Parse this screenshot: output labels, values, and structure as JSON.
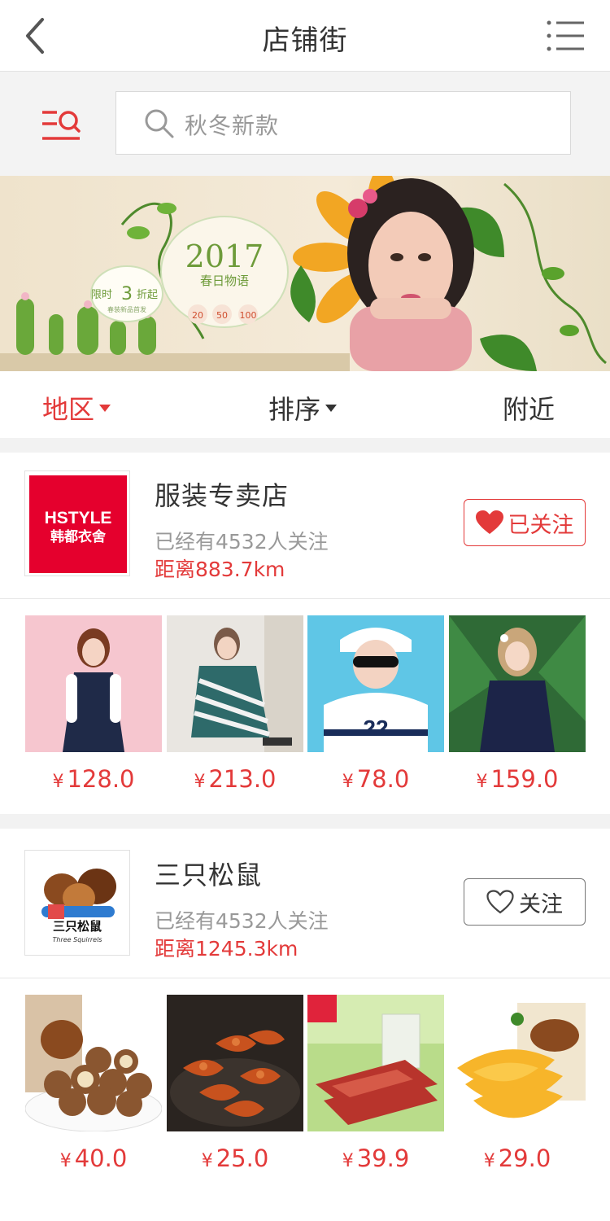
{
  "header": {
    "title": "店铺街"
  },
  "search": {
    "placeholder": "秋冬新款"
  },
  "banner": {
    "promo_prefix": "限时",
    "promo_number": "3",
    "promo_suffix": "折起",
    "promo_sub": "春装新品首发",
    "year": "2017",
    "tagline": "春日物语",
    "coupons": [
      "20",
      "50",
      "100"
    ]
  },
  "tabs": {
    "region": "地区",
    "sort": "排序",
    "nearby": "附近"
  },
  "stores": [
    {
      "name": "服装专卖店",
      "logo_text_1": "HSTYLE",
      "logo_text_2": "韩都衣舍",
      "followers": "已经有4532人关注",
      "distance": "距离883.7km",
      "follow_label": "已关注",
      "products": [
        {
          "currency": "¥",
          "price": "128.0"
        },
        {
          "currency": "¥",
          "price": "213.0"
        },
        {
          "currency": "¥",
          "price": "78.0"
        },
        {
          "currency": "¥",
          "price": "159.0"
        }
      ]
    },
    {
      "name": "三只松鼠",
      "logo_text_1": "三只松鼠",
      "logo_text_2": "Three Squirrels",
      "followers": "已经有4532人关注",
      "distance": "距离1245.3km",
      "follow_label": "关注",
      "products": [
        {
          "currency": "¥",
          "price": "40.0"
        },
        {
          "currency": "¥",
          "price": "25.0"
        },
        {
          "currency": "¥",
          "price": "39.9"
        },
        {
          "currency": "¥",
          "price": "29.0"
        }
      ]
    }
  ],
  "colors": {
    "accent": "#e33a3a",
    "logo_red": "#e5002d",
    "band": "#f2f2f2"
  },
  "icons": [
    "back-arrow-icon",
    "list-menu-icon",
    "filter-search-icon",
    "magnifier-icon",
    "heart-filled-icon",
    "heart-outline-icon"
  ]
}
